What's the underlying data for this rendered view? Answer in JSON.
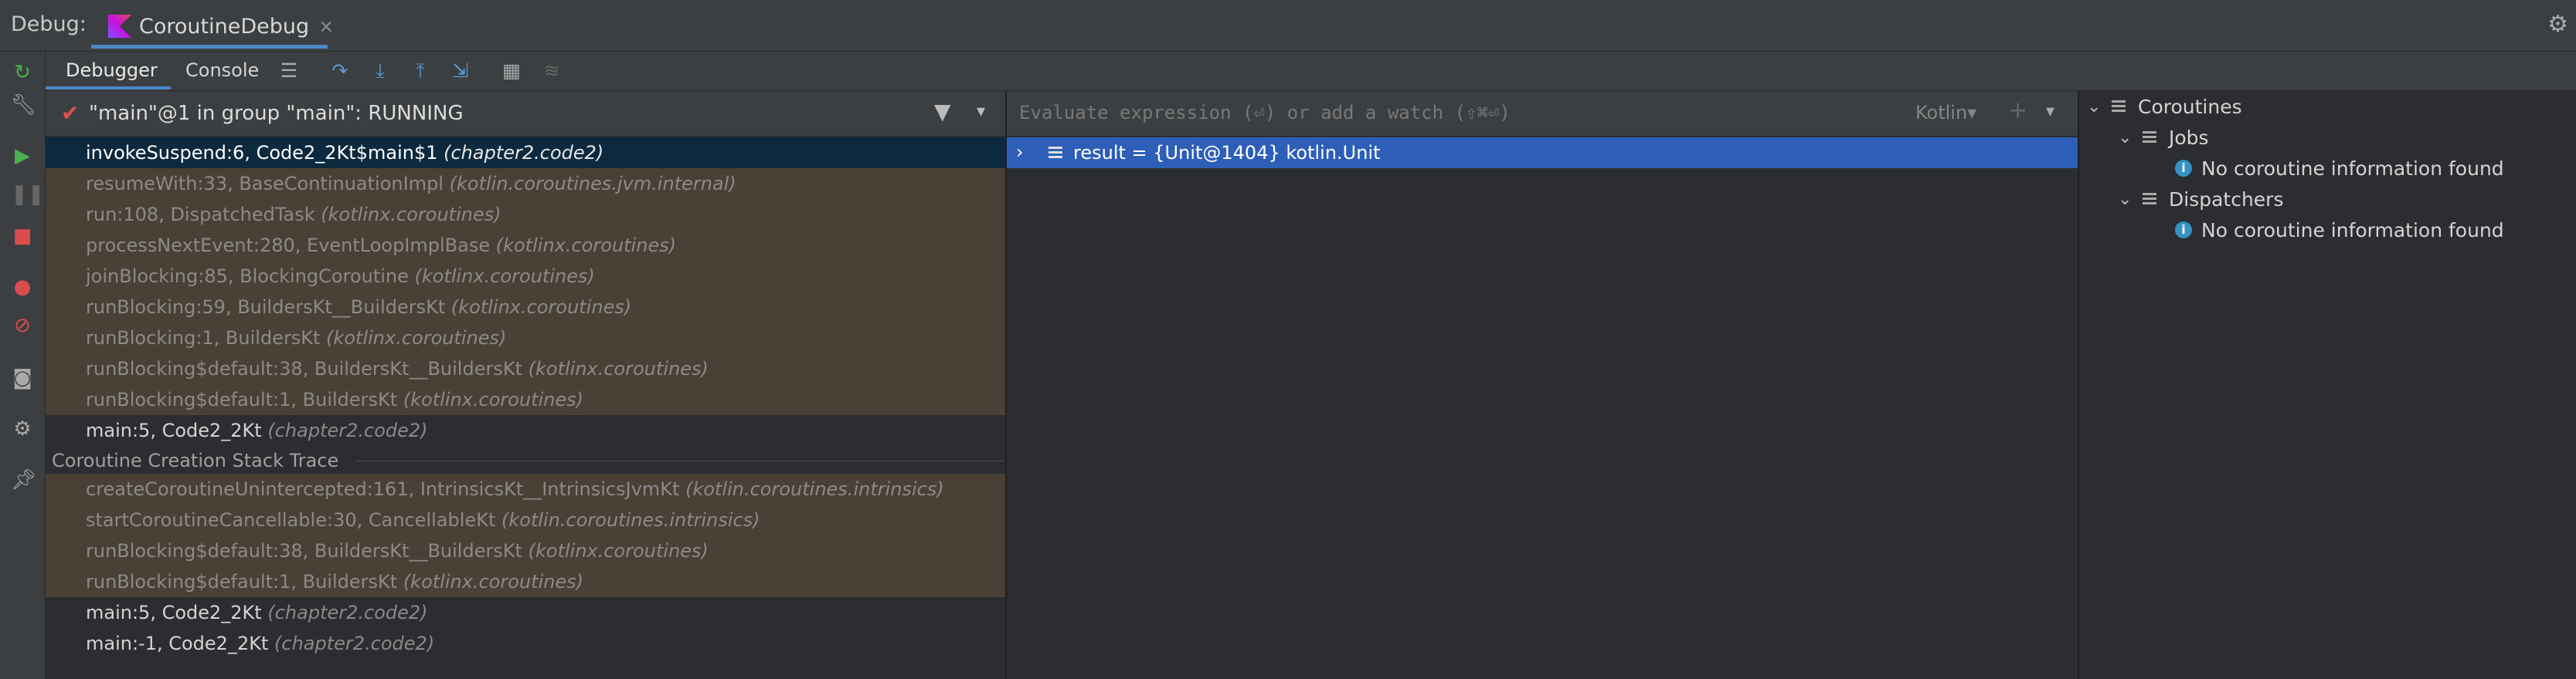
{
  "window": {
    "debug_label": "Debug:",
    "tab_name": "CoroutineDebug",
    "tab_close": "×"
  },
  "toolbar": {
    "tab_debugger": "Debugger",
    "tab_console": "Console"
  },
  "frames_panel": {
    "thread_status": "\"main\"@1 in group \"main\": RUNNING",
    "frames": [
      {
        "method": "invokeSuspend:6, Code2_2Kt$main$1",
        "pkg": "(chapter2.code2)",
        "kind": "sel"
      },
      {
        "method": "resumeWith:33, BaseContinuationImpl",
        "pkg": "(kotlin.coroutines.jvm.internal)",
        "kind": "lib"
      },
      {
        "method": "run:108, DispatchedTask",
        "pkg": "(kotlinx.coroutines)",
        "kind": "lib"
      },
      {
        "method": "processNextEvent:280, EventLoopImplBase",
        "pkg": "(kotlinx.coroutines)",
        "kind": "lib"
      },
      {
        "method": "joinBlocking:85, BlockingCoroutine",
        "pkg": "(kotlinx.coroutines)",
        "kind": "lib"
      },
      {
        "method": "runBlocking:59, BuildersKt__BuildersKt",
        "pkg": "(kotlinx.coroutines)",
        "kind": "lib"
      },
      {
        "method": "runBlocking:1, BuildersKt",
        "pkg": "(kotlinx.coroutines)",
        "kind": "lib"
      },
      {
        "method": "runBlocking$default:38, BuildersKt__BuildersKt",
        "pkg": "(kotlinx.coroutines)",
        "kind": "lib"
      },
      {
        "method": "runBlocking$default:1, BuildersKt",
        "pkg": "(kotlinx.coroutines)",
        "kind": "lib"
      },
      {
        "method": "main:5, Code2_2Kt",
        "pkg": "(chapter2.code2)",
        "kind": "user"
      }
    ],
    "creation_label": "Coroutine Creation Stack Trace",
    "creation_frames": [
      {
        "method": "createCoroutineUnintercepted:161, IntrinsicsKt__IntrinsicsJvmKt",
        "pkg": "(kotlin.coroutines.intrinsics)",
        "kind": "lib"
      },
      {
        "method": "startCoroutineCancellable:30, CancellableKt",
        "pkg": "(kotlin.coroutines.intrinsics)",
        "kind": "lib"
      },
      {
        "method": "runBlocking$default:38, BuildersKt__BuildersKt",
        "pkg": "(kotlinx.coroutines)",
        "kind": "lib"
      },
      {
        "method": "runBlocking$default:1, BuildersKt",
        "pkg": "(kotlinx.coroutines)",
        "kind": "lib"
      },
      {
        "method": "main:5, Code2_2Kt",
        "pkg": "(chapter2.code2)",
        "kind": "user"
      },
      {
        "method": "main:-1, Code2_2Kt",
        "pkg": "(chapter2.code2)",
        "kind": "user"
      }
    ]
  },
  "watches_panel": {
    "placeholder": "Evaluate expression (⏎) or add a watch (⇧⌘⏎)",
    "language": "Kotlin▾",
    "watch_text": "result = {Unit@1404} kotlin.Unit"
  },
  "coroutines_panel": {
    "root": "Coroutines",
    "jobs": "Jobs",
    "jobs_info": "No coroutine information found",
    "dispatchers": "Dispatchers",
    "dispatchers_info": "No coroutine information found"
  },
  "colors": {
    "selected_frame": "#0d293e",
    "library_frame": "#4b4035",
    "watch_selected": "#2e5fb8",
    "accent": "#4a88c7"
  },
  "icons": [
    "kotlin-icon",
    "gear-icon",
    "rerun-icon",
    "wrench-icon",
    "resume-icon",
    "pause-icon",
    "stop-icon",
    "breakpoints-icon",
    "mute-breakpoints-icon",
    "camera-icon",
    "settings-icon",
    "pin-icon",
    "list-icon",
    "step-over-icon",
    "step-into-icon",
    "step-out-icon",
    "run-to-cursor-icon",
    "calculator-icon",
    "trace-icon",
    "filter-icon",
    "chevron-down-icon",
    "info-icon"
  ]
}
